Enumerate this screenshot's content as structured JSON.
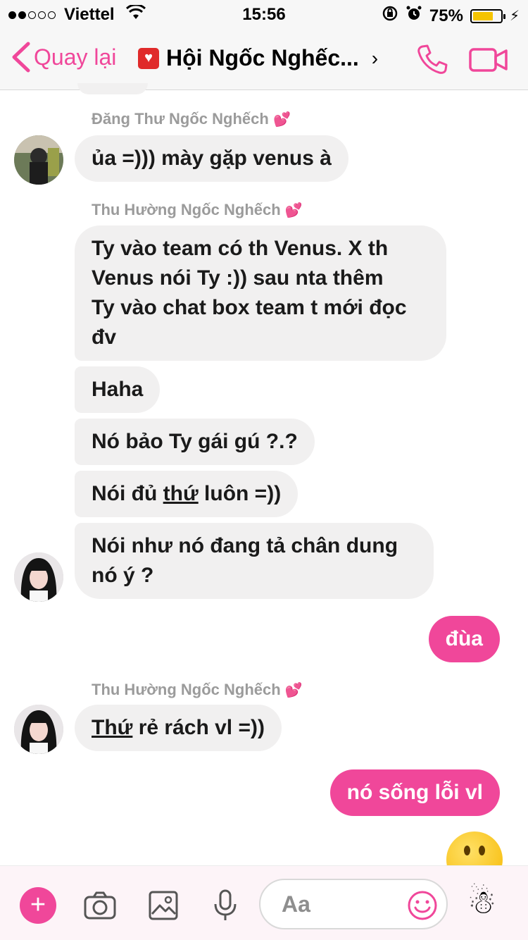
{
  "status_bar": {
    "carrier": "Viettel",
    "time": "15:56",
    "battery": "75%",
    "battery_level": 0.75
  },
  "nav": {
    "back_label": "Quay lại",
    "title": "Hội Ngốc Nghếc..."
  },
  "messages": {
    "sender_1": "Đăng Thư Ngốc Nghếch",
    "msg_1": "ủa =))) mày gặp venus à",
    "sender_2": "Thu Hường Ngốc Nghếch",
    "msg_2_line1": "Ty vào team có th Venus. X th",
    "msg_2_line2": "Venus nói Ty :)) sau nta thêm",
    "msg_2_line3": "Ty vào chat box team t mới đọc",
    "msg_2_line4": "đv",
    "msg_3": "Haha",
    "msg_4": "Nó bảo Ty gái gú ?.?",
    "msg_5_pre": "Nói đủ ",
    "msg_5_under": "thứ",
    "msg_5_post": " luôn =))",
    "msg_6_line1": "Nói như nó đang tả chân dung",
    "msg_6_line2": "nó ý ?",
    "msg_7": "đùa",
    "sender_3": "Thu Hường Ngốc Nghếch",
    "msg_8_under": "Thứ",
    "msg_8_post": " rẻ rách vl =))",
    "msg_9": "nó sống lỗi vl"
  },
  "composer": {
    "placeholder": "Aa"
  },
  "colors": {
    "accent": "#f0479a",
    "incoming_bubble": "#f1f0f0"
  },
  "icons": [
    "back-chevron-icon",
    "heart-icon",
    "phone-icon",
    "video-icon",
    "plus-icon",
    "camera-icon",
    "image-icon",
    "microphone-icon",
    "smiley-icon",
    "snowman-icon"
  ]
}
